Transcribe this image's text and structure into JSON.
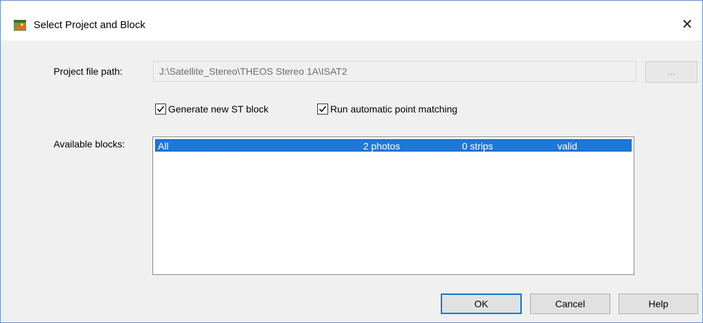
{
  "window": {
    "title": "Select Project and Block"
  },
  "project": {
    "label": "Project file path:",
    "path": "J:\\Satellite_Stereo\\THEOS Stereo 1A\\ISAT2",
    "browse_label": "..."
  },
  "options": {
    "generate_label": "Generate new ST block",
    "generate_checked": true,
    "matching_label": "Run automatic point matching",
    "matching_checked": true
  },
  "blocks": {
    "label": "Available blocks:",
    "items": [
      {
        "name": "All",
        "photos": "2 photos",
        "strips": "0 strips",
        "status": "valid",
        "selected": true
      }
    ]
  },
  "buttons": {
    "ok": "OK",
    "cancel": "Cancel",
    "help": "Help"
  },
  "colors": {
    "selection": "#1e78d7",
    "default_button_border": "#0078d7"
  },
  "icons": {
    "app": "project-map-icon",
    "close": "close-icon"
  }
}
